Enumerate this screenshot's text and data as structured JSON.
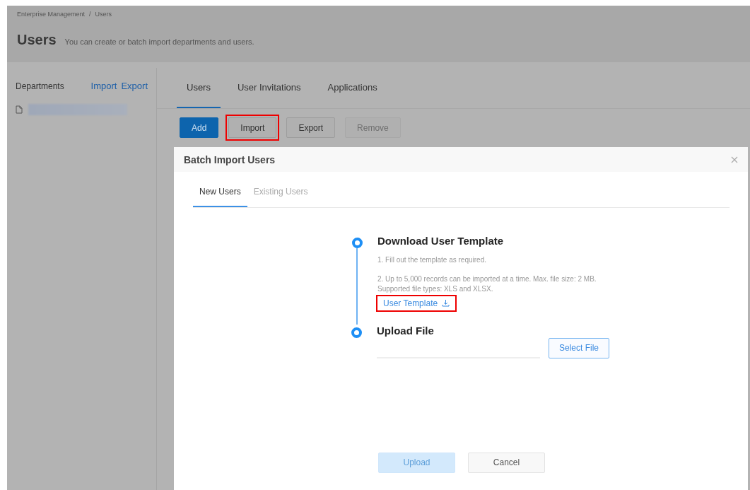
{
  "breadcrumb": [
    "Enterprise Management",
    "/",
    "Users"
  ],
  "page": {
    "title": "Users",
    "subtitle": "You can create or batch import departments and users."
  },
  "sidebar": {
    "title": "Departments",
    "actions": [
      "Import",
      "Export"
    ],
    "items": [
      {
        "kind": "redacted"
      }
    ]
  },
  "tabs": [
    {
      "label": "Users",
      "selected": true
    },
    {
      "label": "User Invitations",
      "selected": false
    },
    {
      "label": "Applications",
      "selected": false
    }
  ],
  "toolbar": [
    {
      "label": "Add",
      "kind": "primary",
      "disabled": false,
      "highlighted": false
    },
    {
      "label": "Import",
      "kind": "default",
      "disabled": false,
      "highlighted": true
    },
    {
      "label": "Export",
      "kind": "default",
      "disabled": false,
      "highlighted": false
    },
    {
      "label": "Remove",
      "kind": "default",
      "disabled": true,
      "highlighted": false
    }
  ],
  "dialog": {
    "title": "Batch Import Users",
    "tabs": [
      {
        "label": "New Users",
        "selected": true
      },
      {
        "label": "Existing Users",
        "selected": false
      }
    ],
    "steps": [
      {
        "title": "Download User Template",
        "notes": [
          "1. Fill out the template as required.",
          "2. Up to 5,000 records can be imported at a time. Max. file size: 2 MB.\nSupported file types: XLS and XLSX."
        ],
        "link": {
          "label": "User Template",
          "highlighted": true
        }
      },
      {
        "title": "Upload File",
        "button": "Select File"
      }
    ],
    "buttons": [
      {
        "label": "Upload",
        "kind": "primary",
        "disabled": true
      },
      {
        "label": "Cancel",
        "kind": "default",
        "disabled": false
      }
    ]
  }
}
